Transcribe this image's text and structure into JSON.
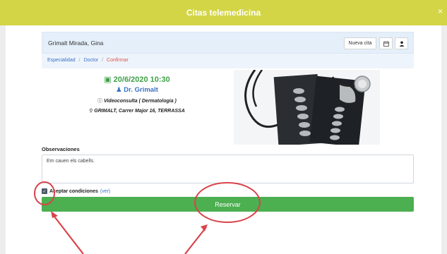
{
  "modal": {
    "title": "Citas telemedicina",
    "close": "×"
  },
  "patient": {
    "name": "Grimalt Mirada, Gina"
  },
  "toolbar": {
    "new_appointment": "Nueva cita"
  },
  "breadcrumb": {
    "step1": "Especialidad",
    "step2": "Doctor",
    "step3": "Confirmar",
    "separator": "/"
  },
  "appointment": {
    "datetime": "20/6/2020 10:30",
    "doctor": "Dr. Grimalt",
    "consult": "Videoconsulta ( Dermatologia )",
    "address": "GRIMALT, Carrer Major 16, TERRASSA"
  },
  "observations": {
    "label": "Observaciones",
    "value": "Em cauen els cabells."
  },
  "terms": {
    "label": "Aceptar condiciones",
    "link": "(ver)",
    "checked": true
  },
  "actions": {
    "reserve": "Reservar"
  },
  "colors": {
    "header": "#d3d546",
    "primary_green": "#4caf50",
    "link_blue": "#3a72c5",
    "annotation_red": "#d9434a"
  }
}
